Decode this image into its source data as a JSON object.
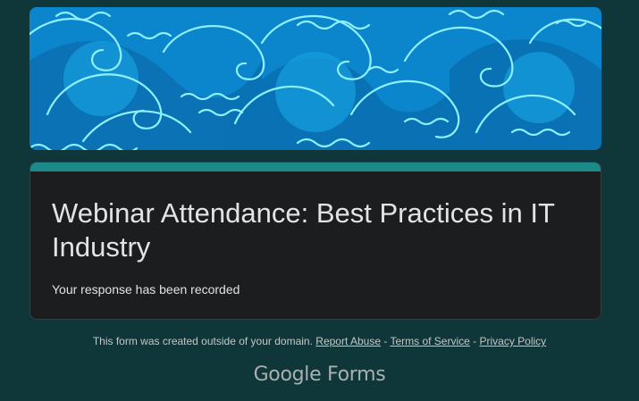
{
  "form": {
    "title": "Webinar Attendance: Best Practices in IT Industry",
    "confirmation": "Your response has been recorded"
  },
  "footer": {
    "prefix": "This form was created outside of your domain.",
    "links": [
      "Report Abuse",
      "Terms of Service",
      "Privacy Policy"
    ],
    "separator": " - "
  },
  "brand": {
    "logo_text": "Google Forms"
  },
  "colors": {
    "page_background": "#0f3638",
    "card_background": "#1c1d1f",
    "card_accent": "#1d8a8a",
    "banner_blue": "#0a82c8",
    "wave_line": "#8ff0ff"
  }
}
